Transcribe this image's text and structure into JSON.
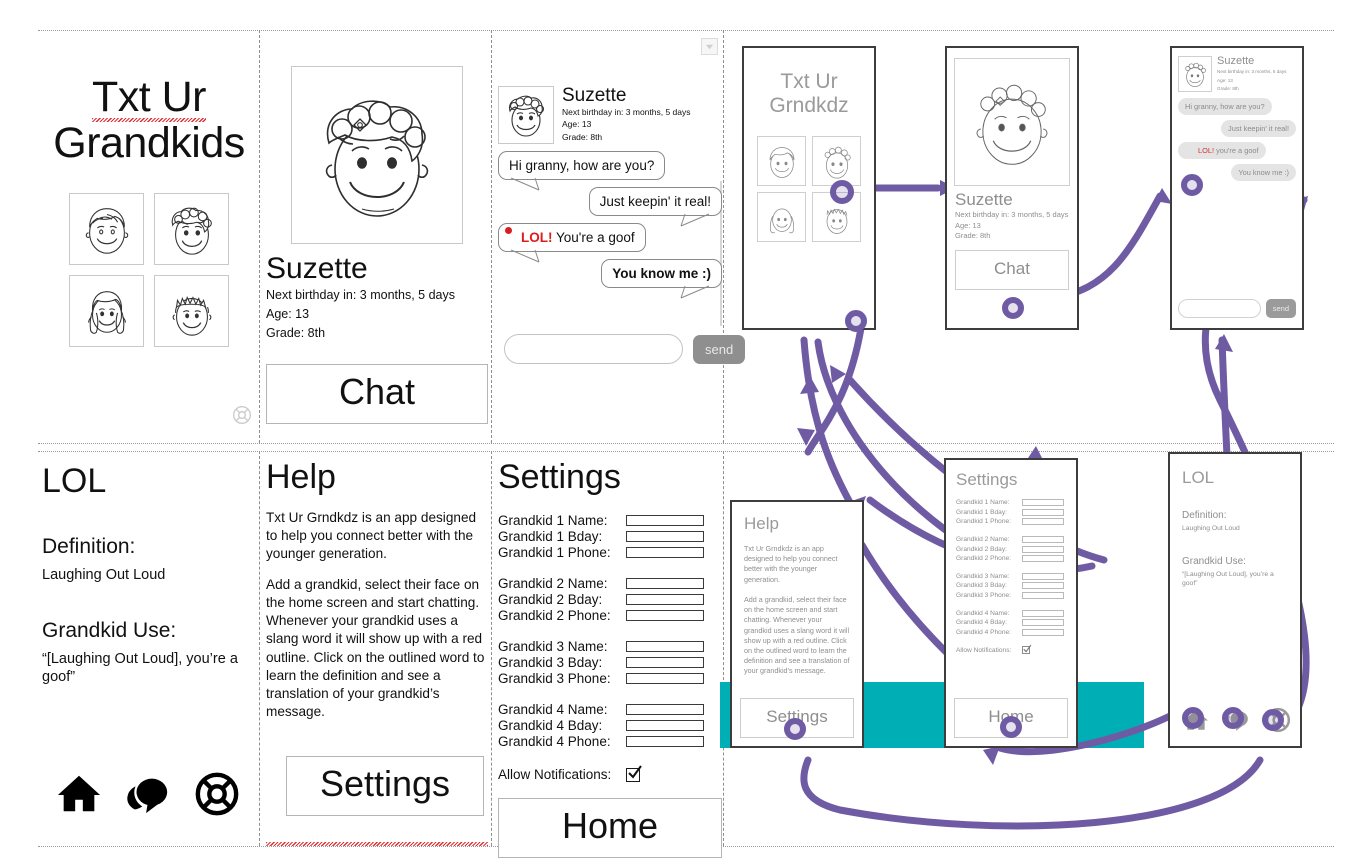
{
  "app": {
    "name": "Txt Ur Grandkids",
    "short_name": "Txt Ur Grndkdz"
  },
  "colors": {
    "teal_band": "#00afb5",
    "arrow_purple": "#6f5ba3",
    "alert_red": "#e01b1b",
    "send_grey": "#8f8f8f"
  },
  "wireframes": {
    "home": {
      "title_line1": "Txt Ur",
      "title_line2": "Grandkids",
      "faces": [
        "face-boy-short-hair",
        "face-curly-hair",
        "face-girl-pigtails",
        "face-spiky-hair"
      ],
      "help_icon": "life-preserver-icon"
    },
    "profile": {
      "name": "Suzette",
      "meta": [
        "Next birthday in: 3 months, 5 days",
        "Age: 13",
        "Grade: 8th"
      ],
      "chat_button": "Chat"
    },
    "chat": {
      "header_name": "Suzette",
      "header_meta": [
        "Next birthday in: 3 months, 5 days",
        "Age: 13",
        "Grade: 8th"
      ],
      "messages": [
        {
          "text": "Hi granny, how are you?",
          "side": "left",
          "bold": false,
          "flagged": false
        },
        {
          "text": "Just keepin' it real!",
          "side": "right",
          "bold": false,
          "flagged": false
        },
        {
          "text": "You're a goof",
          "slang": "LOL!",
          "side": "left",
          "bold": false,
          "flagged": true
        },
        {
          "text": "You know me :)",
          "side": "right",
          "bold": true,
          "flagged": false
        }
      ],
      "input_value": "",
      "input_placeholder": "",
      "send_label": "send",
      "dropdown_icon": "chevron-down-icon"
    },
    "lol": {
      "title": "LOL",
      "definition_head": "Definition:",
      "definition_body": "Laughing Out Loud",
      "usage_head": "Grandkid Use:",
      "usage_body": "“[Laughing Out Loud], you’re a goof”",
      "nav": [
        "home-icon",
        "chat-bubble-icon",
        "life-preserver-icon"
      ]
    },
    "help": {
      "title": "Help",
      "paragraph1_app": "Txt Ur Grndkdz",
      "paragraph1_rest": " is an app designed to help you connect better with the younger generation.",
      "paragraph2": "Add a grandkid, select their face on the home screen and start chatting. Whenever your grandkid uses a slang word it will show up with a red outline. Click on the outlined word to learn the definition and see a translation of your grandkid’s message.",
      "settings_button": "Settings"
    },
    "settings": {
      "title": "Settings",
      "groups": [
        {
          "labels": [
            "Grandkid 1 Name:",
            "Grandkid 1 Bday:",
            "Grandkid 1 Phone:"
          ],
          "values": [
            "",
            "",
            ""
          ]
        },
        {
          "labels": [
            "Grandkid 2 Name:",
            "Grandkid 2 Bday:",
            "Grandkid 2 Phone:"
          ],
          "values": [
            "",
            "",
            ""
          ]
        },
        {
          "labels": [
            "Grandkid 3 Name:",
            "Grandkid 3 Bday:",
            "Grandkid 3 Phone:"
          ],
          "values": [
            "",
            "",
            ""
          ]
        },
        {
          "labels": [
            "Grandkid 4 Name:",
            "Grandkid 4 Bday:",
            "Grandkid 4 Phone:"
          ],
          "values": [
            "",
            "",
            ""
          ]
        }
      ],
      "notifications_label": "Allow Notifications:",
      "notifications_checked": true,
      "home_button": "Home"
    }
  },
  "flow": {
    "screens": [
      {
        "id": "home",
        "title_line1": "Txt Ur",
        "title_line2": "Grndkdz"
      },
      {
        "id": "profile",
        "name": "Suzette",
        "button": "Chat"
      },
      {
        "id": "chat",
        "name": "Suzette",
        "send_label": "send"
      },
      {
        "id": "help",
        "title": "Help",
        "button": "Settings"
      },
      {
        "id": "settings",
        "title": "Settings",
        "button": "Home"
      },
      {
        "id": "lol",
        "title": "LOL"
      }
    ],
    "home": {
      "title_line1": "Txt Ur",
      "title_line2": "Grndkdz"
    },
    "profile": {
      "name": "Suzette",
      "meta": [
        "Next birthday in: 3 months, 5 days",
        "Age: 13",
        "Grade: 8th"
      ],
      "button": "Chat"
    },
    "chat": {
      "name": "Suzette",
      "meta": [
        "Next birthday in: 3 months, 5 days",
        "Age: 13",
        "Grade: 8th"
      ],
      "messages": [
        {
          "text": "Hi granny, how are you?",
          "side": "left"
        },
        {
          "text": "Just keepin' it real!",
          "side": "right"
        },
        {
          "text": "you're a goof",
          "slang": "LOL!",
          "side": "left"
        },
        {
          "text": "You know me :)",
          "side": "right"
        }
      ],
      "send_label": "send"
    },
    "help": {
      "title": "Help",
      "paragraph1": "Txt Ur Grndkdz is an app designed to help you connect better with the younger generation.",
      "paragraph2": "Add a grandkid, select their face on the home screen and start chatting. Whenever your grandkid uses a slang word it will show up with a red outline. Click on the outlined word to learn the definition and see a translation of your grandkid’s message.",
      "button": "Settings"
    },
    "settings": {
      "title": "Settings",
      "groups": [
        [
          "Grandkid 1 Name:",
          "Grandkid 1 Bday:",
          "Grandkid 1 Phone:"
        ],
        [
          "Grandkid 2 Name:",
          "Grandkid 2 Bday:",
          "Grandkid 2 Phone:"
        ],
        [
          "Grandkid 3 Name:",
          "Grandkid 3 Bday:",
          "Grandkid 3 Phone:"
        ],
        [
          "Grandkid 4 Name:",
          "Grandkid 4 Bday:",
          "Grandkid 4 Phone:"
        ]
      ],
      "notifications_label": "Allow Notifications:",
      "button": "Home"
    },
    "lol": {
      "title": "LOL",
      "definition_head": "Definition:",
      "definition_body": "Laughing Out Loud",
      "usage_head": "Grandkid Use:",
      "usage_body": "“[Laughing Out Loud], you’re a goof”",
      "nav": [
        "home-icon",
        "chat-bubble-icon",
        "life-preserver-icon"
      ]
    }
  }
}
